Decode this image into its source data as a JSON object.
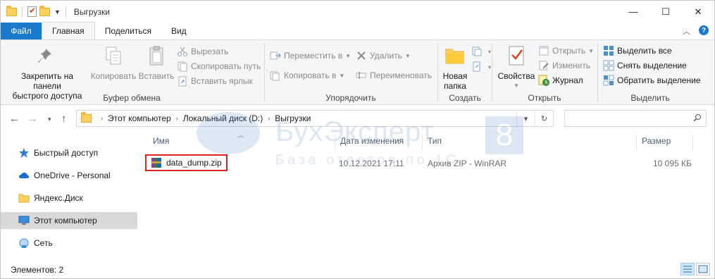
{
  "window": {
    "title": "Выгрузки"
  },
  "window_controls": {
    "minimize": "—",
    "maximize": "☐",
    "close": "✕"
  },
  "tabs": [
    {
      "label": "Файл"
    },
    {
      "label": "Главная"
    },
    {
      "label": "Поделиться"
    },
    {
      "label": "Вид"
    }
  ],
  "ribbon": {
    "clipboard": {
      "label": "Буфер обмена",
      "pin_line1": "Закрепить на панели",
      "pin_line2": "быстрого доступа",
      "copy": "Копировать",
      "paste": "Вставить",
      "cut": "Вырезать",
      "copy_path": "Скопировать путь",
      "paste_shortcut": "Вставить ярлык"
    },
    "organize": {
      "label": "Упорядочить",
      "move_to": "Переместить в",
      "copy_to": "Копировать в",
      "delete": "Удалить",
      "rename": "Переименовать"
    },
    "new": {
      "label": "Создать",
      "new_folder_line1": "Новая",
      "new_folder_line2": "папка"
    },
    "open": {
      "label": "Открыть",
      "properties": "Свойства",
      "open": "Открыть",
      "edit": "Изменить",
      "history": "Журнал"
    },
    "select": {
      "label": "Выделить",
      "select_all": "Выделить все",
      "select_none": "Снять выделение",
      "invert": "Обратить выделение"
    }
  },
  "address": {
    "segments": [
      "Этот компьютер",
      "Локальный диск (D:)",
      "Выгрузки"
    ]
  },
  "nav_pane": {
    "items": [
      {
        "label": "Быстрый доступ",
        "icon": "star-icon"
      },
      {
        "label": "OneDrive - Personal",
        "icon": "cloud-icon"
      },
      {
        "label": "Яндекс.Диск",
        "icon": "folder-icon"
      },
      {
        "label": "Этот компьютер",
        "icon": "computer-icon"
      },
      {
        "label": "Сеть",
        "icon": "network-icon"
      }
    ]
  },
  "file_list": {
    "columns": [
      "Имя",
      "Дата изменения",
      "Тип",
      "Размер"
    ],
    "rows": [
      {
        "name": "data_dump.zip",
        "date": "10.12.2021 17:11",
        "type": "Архив ZIP - WinRAR",
        "size": "10 095 КБ"
      }
    ]
  },
  "watermark": {
    "title": "БухЭксперт",
    "badge": "8",
    "subtitle": "База ответов по 1С"
  },
  "status": {
    "items": "Элементов: 2"
  },
  "colors": {
    "file_tab": "#1979ca",
    "highlight_border": "#e02020",
    "selected_nav": "#d9d9d9"
  }
}
